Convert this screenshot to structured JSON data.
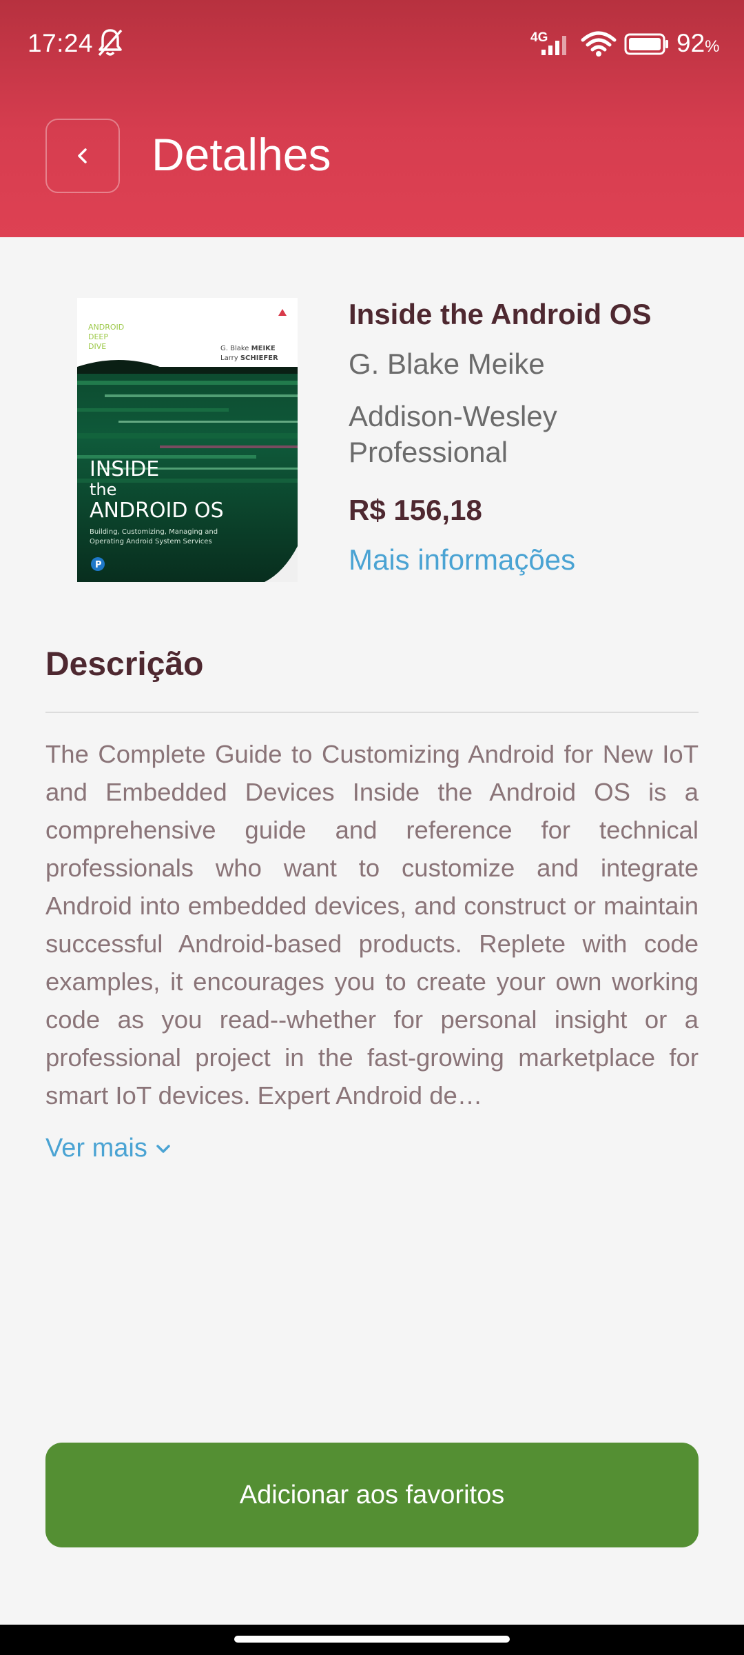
{
  "status_bar": {
    "time": "17:24",
    "network_type": "4G",
    "battery_percent": "92",
    "battery_unit": "%"
  },
  "header": {
    "title": "Detalhes",
    "back_icon": "chevron-left-icon"
  },
  "book": {
    "title": "Inside the Android OS",
    "author": "G. Blake Meike",
    "publisher": "Addison-Wesley Professional",
    "price": "R$ 156,18",
    "more_info_link": "Mais informações",
    "cover": {
      "series_line1": "ANDROID",
      "series_line2": "DEEP",
      "series_line3": "DIVE",
      "author1_first": "G. Blake",
      "author1_last": "MEIKE",
      "author2_first": "Larry",
      "author2_last": "SCHIEFER",
      "title_line1": "INSIDE",
      "title_line2": "the",
      "title_line3": "ANDROID",
      "title_line3_suffix": "OS",
      "subtitle_line1": "Building, Customizing, Managing and",
      "subtitle_line2": "Operating Android System Services",
      "publisher_mark": "P"
    }
  },
  "description": {
    "heading": "Descrição",
    "text": "The Complete Guide to Customizing Android for New IoT and Embedded Devices Inside the Android OS is a comprehensive guide and reference for technical professionals who want to customize and integrate Android into embedded devices, and construct or maintain successful Android-based products. Replete with code examples, it encourages you to create your own working code as you read--whether for personal insight or a professional project in the fast-growing marketplace for smart IoT devices. Expert Android de…",
    "see_more": "Ver mais"
  },
  "actions": {
    "favorite_button": "Adicionar aos favoritos"
  },
  "colors": {
    "header_top": "#b7313f",
    "header_bottom": "#de4153",
    "accent_link": "#4aa3d3",
    "title_text": "#4e2830",
    "favorite_button": "#548f33"
  }
}
